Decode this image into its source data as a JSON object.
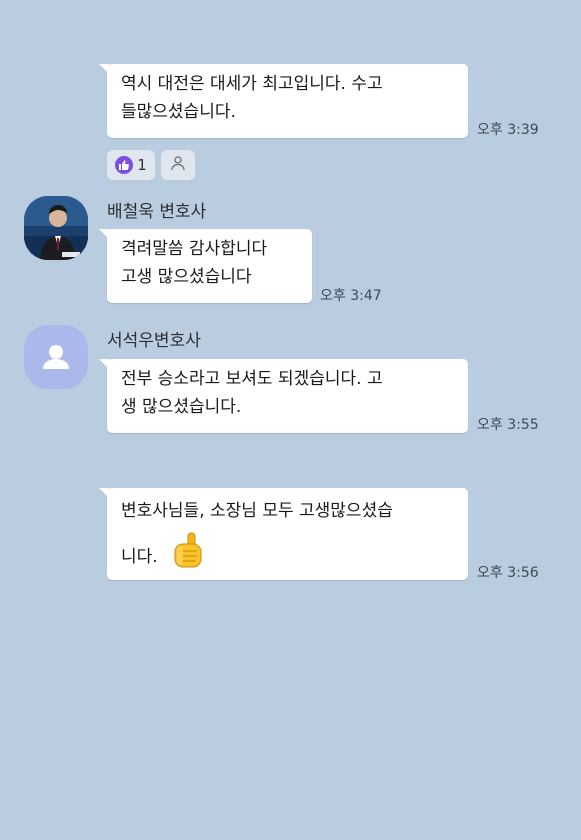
{
  "messages": [
    {
      "lines": [
        "역시 대전은 대세가 최고입니다. 수고",
        "들많으셨습니다."
      ],
      "time": "오후 3:39",
      "reactions": {
        "like_count": "1"
      }
    },
    {
      "sender": "배철욱 변호사",
      "lines": [
        "격려말씀 감사합니다",
        "고생 많으셨습니다"
      ],
      "time": "오후 3:47"
    },
    {
      "sender": "서석우변호사",
      "lines": [
        "전부 승소라고 보셔도 되겠습니다. 고",
        "생 많으셨습니다."
      ],
      "time": "오후 3:55"
    },
    {
      "lines": [
        "변호사님들, 소장님 모두 고생많으셨습",
        "니다."
      ],
      "time": "오후 3:56",
      "emoji": "thumbs-up"
    }
  ],
  "colors": {
    "background": "#b9cce0",
    "bubble": "#ffffff",
    "like_badge": "#7a4fe0",
    "default_avatar": "#aab8ec"
  }
}
